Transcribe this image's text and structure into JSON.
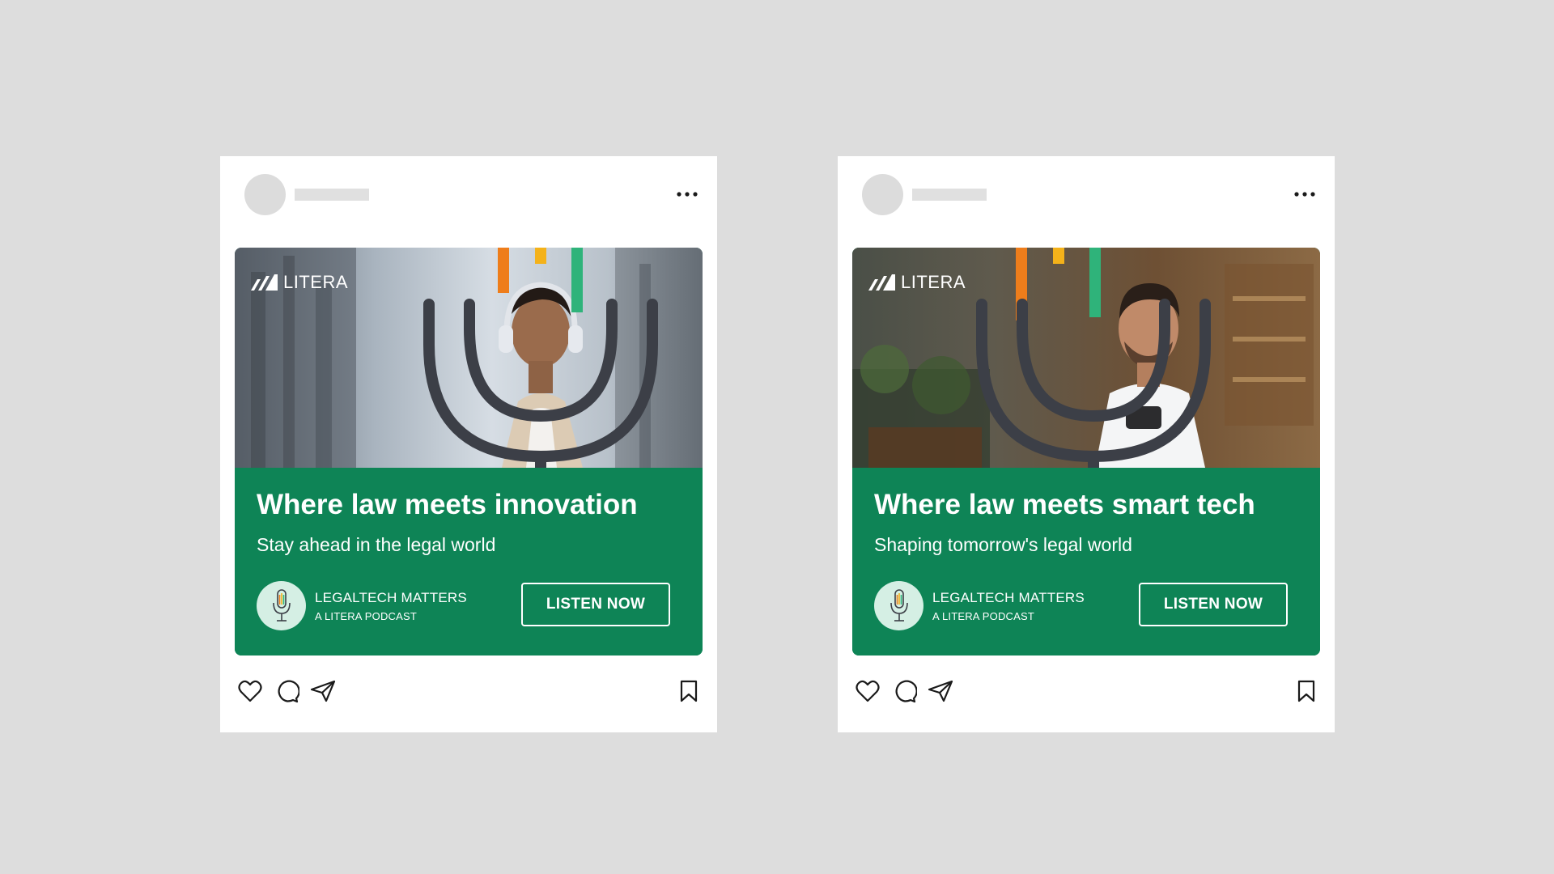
{
  "colors": {
    "background": "#dddddd",
    "card": "#ffffff",
    "brand_green": "#0e8456",
    "mic_dark": "#3c3f47",
    "accent_orange": "#ee7d1b",
    "accent_yellow": "#f4b21a",
    "accent_green": "#2fb37a",
    "badge_mint": "#d5efe4"
  },
  "icons": {
    "more": "more-dots-icon",
    "like": "heart-icon",
    "comment": "comment-icon",
    "share": "paper-plane-icon",
    "bookmark": "bookmark-icon",
    "podcast": "microphone-icon",
    "logo": "litera-logo-mark"
  },
  "posts": [
    {
      "brand": "LITERA",
      "headline": "Where law meets innovation",
      "subhead": "Stay ahead in the legal world",
      "podcast_title": "LEGALTECH MATTERS",
      "podcast_sub": "A LITERA PODCAST",
      "cta": "LISTEN NOW"
    },
    {
      "brand": "LITERA",
      "headline": "Where law meets smart tech",
      "subhead": "Shaping tomorrow's legal world",
      "podcast_title": "LEGALTECH MATTERS",
      "podcast_sub": "A LITERA PODCAST",
      "cta": "LISTEN NOW"
    }
  ]
}
